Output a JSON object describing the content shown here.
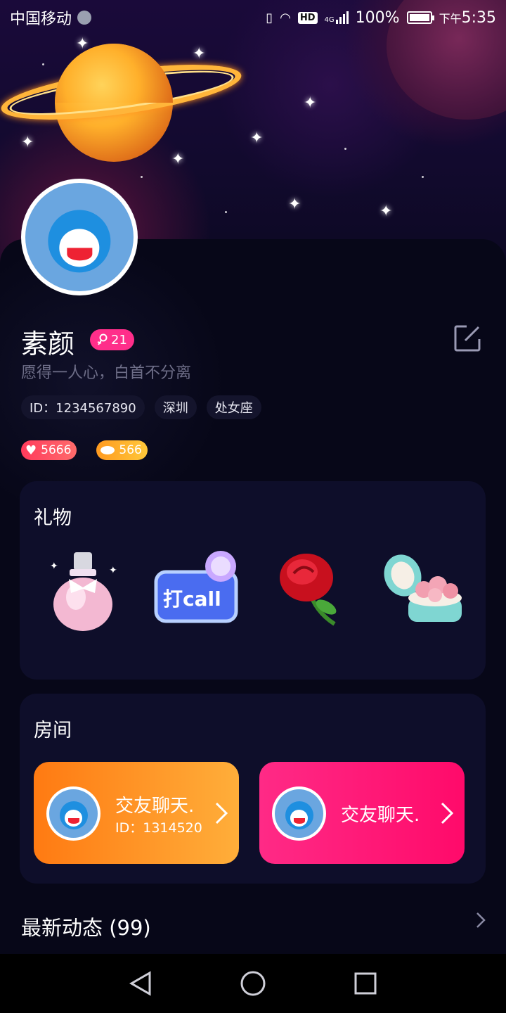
{
  "status_bar": {
    "carrier": "中国移动",
    "network_badge": "HD",
    "network_type": "4G",
    "battery": "100%",
    "time_prefix": "下午",
    "time": "5:35"
  },
  "profile": {
    "name": "素颜",
    "age": "21",
    "signature": "愿得一人心，白首不分离",
    "tags": [
      "ID：1234567890",
      "深圳",
      "处女座"
    ],
    "likes": "5666",
    "coins": "566"
  },
  "gifts_card": {
    "title": "礼物",
    "items": [
      {
        "icon": "perfume-icon"
      },
      {
        "icon": "call-sign-icon",
        "text": "打call"
      },
      {
        "icon": "rose-icon"
      },
      {
        "icon": "flower-box-icon"
      }
    ]
  },
  "rooms_card": {
    "title": "房间",
    "rooms": [
      {
        "name": "交友聊天.",
        "id": "ID：1314520",
        "color": "#ff8a1f"
      },
      {
        "name": "交友聊天.",
        "id": "",
        "color": "#ff1a78"
      }
    ]
  },
  "feed": {
    "title": "最新动态 (99)"
  },
  "colors": {
    "accent_pink": "#ff2e8a",
    "card_bg": "#0e0e2a",
    "panel_bg": "#070718"
  }
}
